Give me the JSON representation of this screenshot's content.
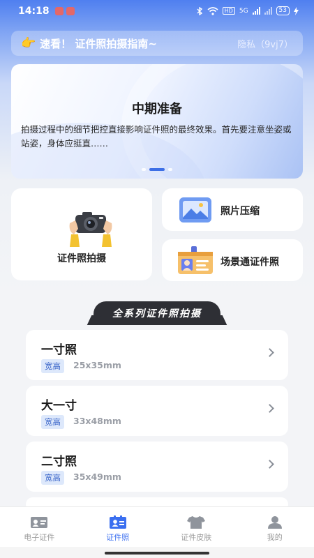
{
  "status_bar": {
    "time": "14:18",
    "network_type": "HD",
    "signal_label": "5G",
    "battery": "53"
  },
  "notice": {
    "icon": "pointing-hand-icon",
    "text": "速看！ 证件照拍摄指南~",
    "privacy": "隐私（9vj7）"
  },
  "banner": {
    "title": "中期准备",
    "text": "拍摄过程中的细节把控直接影响证件照的最终效果。首先要注意坐姿或站姿，身体应挺直……",
    "active_slide": 2,
    "total_slides": 3
  },
  "features": {
    "photo": {
      "label": "证件照拍摄",
      "icon": "camera-hands-icon"
    },
    "compress": {
      "label": "照片压缩",
      "icon": "image-icon"
    },
    "scene": {
      "label": "场景通证件照",
      "icon": "id-card-icon"
    }
  },
  "series": {
    "title": "全系列证件照拍摄"
  },
  "sizes": [
    {
      "name": "一寸照",
      "tag": "宽高",
      "dim": "25x35mm"
    },
    {
      "name": "大一寸",
      "tag": "宽高",
      "dim": "33x48mm"
    },
    {
      "name": "二寸照",
      "tag": "宽高",
      "dim": "35x49mm"
    }
  ],
  "nav": [
    {
      "label": "电子证件",
      "icon": "id-card-icon",
      "active": false
    },
    {
      "label": "证件照",
      "icon": "portrait-card-icon",
      "active": true
    },
    {
      "label": "证件皮肤",
      "icon": "tshirt-icon",
      "active": false
    },
    {
      "label": "我的",
      "icon": "user-icon",
      "active": false
    }
  ],
  "colors": {
    "accent": "#3b6ff0",
    "header_gradient_top": "#4f7ff0",
    "series_tab": "#2e2f35",
    "tag_bg": "#dde8fb"
  }
}
